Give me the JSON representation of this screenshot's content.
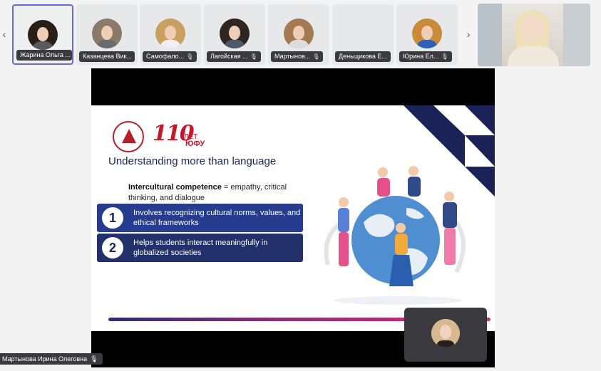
{
  "participants": [
    {
      "name": "Жарина Ольга ...",
      "hair": "#2a1e18",
      "shirt": "#5a5a5a",
      "active": true
    },
    {
      "name": "Казанцева Вик...",
      "hair": "#8a7a6a",
      "shirt": "#6b6b6b",
      "active": false
    },
    {
      "name": "Самофало...",
      "hair": "#c9a060",
      "shirt": "#f0f0f0",
      "active": false
    },
    {
      "name": "Лагойская ...",
      "hair": "#2e2620",
      "shirt": "#4a5a6a",
      "active": false
    },
    {
      "name": "Мартынов...",
      "hair": "#a37b52",
      "shirt": "#dcdcdc",
      "active": false
    },
    {
      "name": "Деньщикова Е...",
      "hair": "",
      "shirt": "",
      "active": false
    },
    {
      "name": "Юрина Ел...",
      "hair": "#c98a3a",
      "shirt": "#2f5fb8",
      "active": false
    }
  ],
  "presenter_name": "Мартынова Ирина Олеговна",
  "slide": {
    "logo_110": "110",
    "logo_let": "ЛЕТ",
    "logo_sfedu": "ЮФУ",
    "title": "Understanding more than language",
    "competence_bold": "Intercultural competence",
    "competence_rest": " = empathy, critical thinking, and dialogue",
    "points": [
      {
        "num": "1",
        "text": "Involves recognizing cultural norms, values, and ethical frameworks"
      },
      {
        "num": "2",
        "text": "Helps students interact meaningfully in globalized societies"
      }
    ]
  },
  "colors": {
    "accent": "#6b66d9",
    "navy": "#1b2257",
    "blue": "#263c8e",
    "red": "#c6172a",
    "pink": "#d8286e"
  }
}
